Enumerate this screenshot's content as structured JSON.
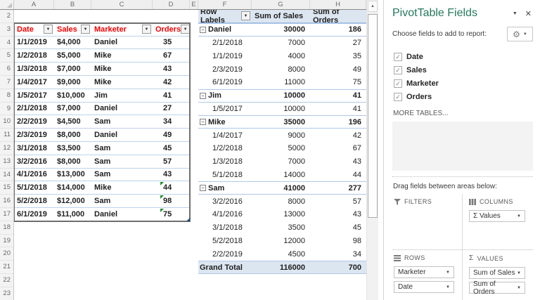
{
  "grid": {
    "column_letters": [
      "A",
      "B",
      "C",
      "D",
      "E",
      "F",
      "G",
      "H"
    ],
    "row_numbers": [
      2,
      3,
      4,
      5,
      6,
      7,
      8,
      9,
      10,
      11,
      12,
      13,
      14,
      15,
      16,
      17,
      18,
      19,
      20,
      21,
      22,
      23
    ]
  },
  "data_table": {
    "headers": [
      "Date",
      "Sales",
      "Marketer",
      "Orders"
    ],
    "rows": [
      {
        "date": "1/1/2019",
        "sales": "$4,000",
        "marketer": "Daniel",
        "orders": "35",
        "flag": false
      },
      {
        "date": "1/2/2018",
        "sales": "$5,000",
        "marketer": "Mike",
        "orders": "67",
        "flag": false
      },
      {
        "date": "1/3/2018",
        "sales": "$7,000",
        "marketer": "Mike",
        "orders": "43",
        "flag": false
      },
      {
        "date": "1/4/2017",
        "sales": "$9,000",
        "marketer": "Mike",
        "orders": "42",
        "flag": false
      },
      {
        "date": "1/5/2017",
        "sales": "$10,000",
        "marketer": "Jim",
        "orders": "41",
        "flag": false
      },
      {
        "date": "2/1/2018",
        "sales": "$7,000",
        "marketer": "Daniel",
        "orders": "27",
        "flag": false
      },
      {
        "date": "2/2/2019",
        "sales": "$4,500",
        "marketer": "Sam",
        "orders": "34",
        "flag": false
      },
      {
        "date": "2/3/2019",
        "sales": "$8,000",
        "marketer": "Daniel",
        "orders": "49",
        "flag": false
      },
      {
        "date": "3/1/2018",
        "sales": "$3,500",
        "marketer": "Sam",
        "orders": "45",
        "flag": false
      },
      {
        "date": "3/2/2016",
        "sales": "$8,000",
        "marketer": "Sam",
        "orders": "57",
        "flag": false
      },
      {
        "date": "4/1/2016",
        "sales": "$13,000",
        "marketer": "Sam",
        "orders": "43",
        "flag": false
      },
      {
        "date": "5/1/2018",
        "sales": "$14,000",
        "marketer": "Mike",
        "orders": "44",
        "flag": true
      },
      {
        "date": "5/2/2018",
        "sales": "$12,000",
        "marketer": "Sam",
        "orders": "98",
        "flag": true
      },
      {
        "date": "6/1/2019",
        "sales": "$11,000",
        "marketer": "Daniel",
        "orders": "75",
        "flag": true
      }
    ]
  },
  "pivot_table": {
    "headers": [
      "Row Labels",
      "Sum of Sales",
      "Sum of Orders"
    ],
    "rows": [
      {
        "type": "group",
        "label": "Daniel",
        "sales": "30000",
        "orders": "186"
      },
      {
        "type": "detail",
        "label": "2/1/2018",
        "sales": "7000",
        "orders": "27"
      },
      {
        "type": "detail",
        "label": "1/1/2019",
        "sales": "4000",
        "orders": "35"
      },
      {
        "type": "detail",
        "label": "2/3/2019",
        "sales": "8000",
        "orders": "49"
      },
      {
        "type": "detail",
        "label": "6/1/2019",
        "sales": "11000",
        "orders": "75"
      },
      {
        "type": "group",
        "label": "Jim",
        "sales": "10000",
        "orders": "41"
      },
      {
        "type": "detail",
        "label": "1/5/2017",
        "sales": "10000",
        "orders": "41"
      },
      {
        "type": "group",
        "label": "Mike",
        "sales": "35000",
        "orders": "196"
      },
      {
        "type": "detail",
        "label": "1/4/2017",
        "sales": "9000",
        "orders": "42"
      },
      {
        "type": "detail",
        "label": "1/2/2018",
        "sales": "5000",
        "orders": "67"
      },
      {
        "type": "detail",
        "label": "1/3/2018",
        "sales": "7000",
        "orders": "43"
      },
      {
        "type": "detail",
        "label": "5/1/2018",
        "sales": "14000",
        "orders": "44"
      },
      {
        "type": "group",
        "label": "Sam",
        "sales": "41000",
        "orders": "277"
      },
      {
        "type": "detail",
        "label": "3/2/2016",
        "sales": "8000",
        "orders": "57"
      },
      {
        "type": "detail",
        "label": "4/1/2016",
        "sales": "13000",
        "orders": "43"
      },
      {
        "type": "detail",
        "label": "3/1/2018",
        "sales": "3500",
        "orders": "45"
      },
      {
        "type": "detail",
        "label": "5/2/2018",
        "sales": "12000",
        "orders": "98"
      },
      {
        "type": "detail",
        "label": "2/2/2019",
        "sales": "4500",
        "orders": "34"
      },
      {
        "type": "grand",
        "label": "Grand Total",
        "sales": "116000",
        "orders": "700"
      }
    ]
  },
  "panel": {
    "title": "PivotTable Fields",
    "choose_label": "Choose fields to add to report:",
    "fields": [
      {
        "label": "Date",
        "checked": true
      },
      {
        "label": "Sales",
        "checked": true
      },
      {
        "label": "Marketer",
        "checked": true
      },
      {
        "label": "Orders",
        "checked": true
      }
    ],
    "more_tables": "MORE TABLES...",
    "drag_label": "Drag fields between areas below:",
    "areas": {
      "filters": {
        "label": "FILTERS",
        "items": []
      },
      "columns": {
        "label": "COLUMNS",
        "items": [
          "Σ Values"
        ]
      },
      "rows": {
        "label": "ROWS",
        "items": [
          "Marketer",
          "Date"
        ]
      },
      "values": {
        "label": "VALUES",
        "items": [
          "Sum of Sales",
          "Sum of Orders"
        ]
      }
    }
  },
  "icons": {
    "caret_down": "▼",
    "pane_options": "▼",
    "close": "✕",
    "gear": "⚙",
    "scroll_up": "▲",
    "sigma": "Σ",
    "check": "✓",
    "minus": "−"
  },
  "colors": {
    "pane_title_green": "#26785C",
    "table_header_red": "#F50000",
    "pivot_header_bg": "#DCE6F1",
    "row_separator_blue": "#BDD2EA",
    "flag_green": "#1E8E2E"
  }
}
